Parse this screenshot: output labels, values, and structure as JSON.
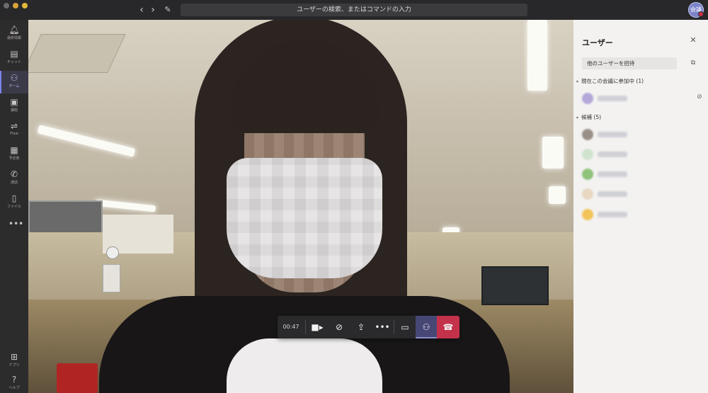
{
  "window": {
    "search_placeholder": "ユーザーの検索、またはコマンドの入力",
    "me_initials": "会議"
  },
  "icons": {
    "back": "chevron-left",
    "forward": "chevron-right",
    "compose": "compose",
    "activity": "bell",
    "chat": "chat-bubble",
    "teams": "teams",
    "assignments": "clipboard",
    "flow": "flow",
    "calendar": "calendar",
    "calls": "phone",
    "files": "file",
    "more": "ellipsis",
    "apps": "apps-grid",
    "help": "question"
  },
  "rail": {
    "activity": "最新情報",
    "chat": "チャット",
    "teams": "チーム",
    "assignments": "課題",
    "flow": "Flow",
    "calendar": "予定表",
    "calls": "通話",
    "files": "ファイル",
    "more": "•••",
    "apps": "アプリ",
    "help": "ヘルプ"
  },
  "call": {
    "timer": "00:47"
  },
  "panel": {
    "title": "ユーザー",
    "invite_label": "他のユーザーを招待",
    "in_meeting_label": "現在この会議に参加中 (1)",
    "candidates_label": "候補 (5)"
  },
  "colors": {
    "accent": "#7b83eb",
    "hangup": "#c4314b",
    "rail_bg": "#2d2c2c",
    "panel_bg": "#f3f2f1"
  }
}
